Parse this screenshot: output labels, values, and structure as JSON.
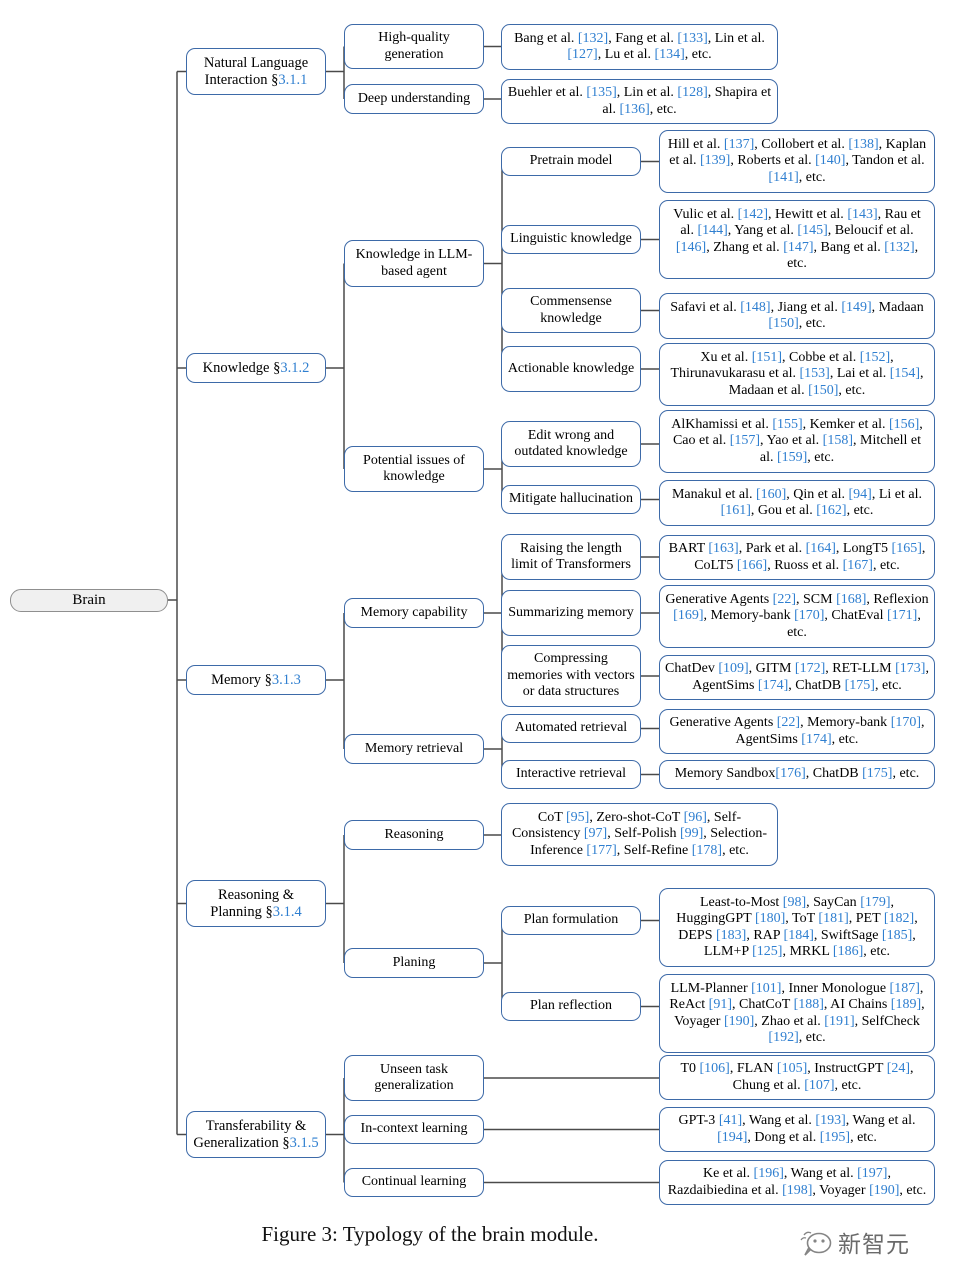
{
  "figure": {
    "caption": "Figure 3: Typology of the brain module.",
    "watermark_text": "新智元",
    "watermark_icon": "speech-bubble-icon",
    "accent_border_color": "#3d6aa8",
    "citation_color": "#2f7fd0",
    "root_fill_color": "#f0f0f0"
  },
  "root": {
    "label": "Brain"
  },
  "branches": [
    {
      "id": "natural-language-interaction",
      "label": "Natural Language Interaction §3.1.1",
      "label_main": "Natural Language",
      "label_section": "Interaction §3.1.1",
      "children": [
        {
          "id": "high-quality-generation",
          "label": "High-quality generation",
          "leaf": "Bang et al. [132], Fang et al. [133], Lin et al. [127], Lu et al. [134], etc."
        },
        {
          "id": "deep-understanding",
          "label": "Deep understanding",
          "leaf": "Buehler et al. [135], Lin et al. [128], Shapira et al. [136], etc."
        }
      ]
    },
    {
      "id": "knowledge",
      "label": "Knowledge §3.1.2",
      "children": [
        {
          "id": "knowledge-in-llm-based-agent",
          "label": "Knowledge in LLM-based agent",
          "children": [
            {
              "id": "pretrain-model",
              "label": "Pretrain model",
              "leaf": "Hill et al. [137], Collobert et al. [138], Kaplan et al. [139], Roberts et al. [140], Tandon et al. [141], etc."
            },
            {
              "id": "linguistic-knowledge",
              "label": "Linguistic knowledge",
              "leaf": "Vulic et al. [142], Hewitt et al. [143], Rau et al. [144], Yang et al. [145], Beloucif et al. [146], Zhang et al. [147], Bang et al. [132], etc."
            },
            {
              "id": "commensense-knowledge",
              "label": "Commensense knowledge",
              "leaf": "Safavi et al. [148], Jiang et al. [149], Madaan [150], etc."
            },
            {
              "id": "actionable-knowledge",
              "label": "Actionable knowledge",
              "leaf": "Xu et al. [151], Cobbe et al. [152], Thirunavukarasu et al. [153], Lai et al. [154], Madaan et al. [150], etc."
            }
          ]
        },
        {
          "id": "potential-issues-of-knowledge",
          "label": "Potential issues of knowledge",
          "children": [
            {
              "id": "edit-wrong-and-outdated-knowledge",
              "label": "Edit wrong and outdated knowledge",
              "leaf": "AlKhamissi et al. [155], Kemker et al. [156], Cao et al. [157], Yao et al. [158], Mitchell et al. [159], etc."
            },
            {
              "id": "mitigate-hallucination",
              "label": "Mitigate hallucination",
              "leaf": "Manakul et al. [160], Qin et al. [94], Li et al. [161], Gou et al. [162], etc."
            }
          ]
        }
      ]
    },
    {
      "id": "memory",
      "label": "Memory §3.1.3",
      "children": [
        {
          "id": "memory-capability",
          "label": "Memory capability",
          "children": [
            {
              "id": "raising-the-length-limit-of-transformers",
              "label": "Raising the length limit of Transformers",
              "leaf": "BART [163], Park et al. [164], LongT5 [165], CoLT5 [166], Ruoss et al. [167], etc."
            },
            {
              "id": "summarizing-memory",
              "label": "Summarizing memory",
              "leaf": "Generative Agents [22], SCM [168], Reflexion [169], Memory-bank [170], ChatEval [171], etc."
            },
            {
              "id": "compressing-memories-with-vectors-or-data-structures",
              "label": "Compressing memories with vectors or data structures",
              "leaf": "ChatDev [109], GITM [172], RET-LLM [173], AgentSims [174], ChatDB [175], etc."
            }
          ]
        },
        {
          "id": "memory-retrieval",
          "label": "Memory retrieval",
          "children": [
            {
              "id": "automated-retrieval",
              "label": "Automated retrieval",
              "leaf": "Generative Agents [22], Memory-bank [170], AgentSims [174], etc."
            },
            {
              "id": "interactive-retrieval",
              "label": "Interactive retrieval",
              "leaf": "Memory Sandbox[176], ChatDB [175], etc."
            }
          ]
        }
      ]
    },
    {
      "id": "reasoning-and-planning",
      "label": "Reasoning & Planning §3.1.4",
      "label_main": "Reasoning &",
      "label_section": "Planning §3.1.4",
      "children": [
        {
          "id": "reasoning",
          "label": "Reasoning",
          "leaf": "CoT [95], Zero-shot-CoT [96], Self-Consistency [97], Self-Polish [99], Selection-Inference [177], Self-Refine [178], etc."
        },
        {
          "id": "planing",
          "label": "Planing",
          "children": [
            {
              "id": "plan-formulation",
              "label": "Plan formulation",
              "leaf": "Least-to-Most [98], SayCan [179], HuggingGPT [180], ToT [181], PET [182], DEPS [183], RAP [184], SwiftSage [185], LLM+P [125], MRKL [186], etc."
            },
            {
              "id": "plan-reflection",
              "label": "Plan reflection",
              "leaf": "LLM-Planner [101], Inner Monologue [187], ReAct [91], ChatCoT [188], AI Chains [189], Voyager [190], Zhao et al. [191], SelfCheck [192], etc."
            }
          ]
        }
      ]
    },
    {
      "id": "transferability-and-generalization",
      "label": "Transferability & Generalization §3.1.5",
      "label_main": "Transferability &",
      "label_section": "Generalization §3.1.5",
      "children": [
        {
          "id": "unseen-task-generalization",
          "label": "Unseen task generalization",
          "leaf": "T0 [106], FLAN [105], InstructGPT [24], Chung et al. [107], etc."
        },
        {
          "id": "in-context-learning",
          "label": "In-context learning",
          "leaf": "GPT-3 [41], Wang et al. [193], Wang et al. [194], Dong et al. [195], etc."
        },
        {
          "id": "continual-learning",
          "label": "Continual learning",
          "leaf": "Ke et al. [196], Wang et al. [197], Razdaibiedina et al. [198], Voyager [190], etc."
        }
      ]
    }
  ]
}
